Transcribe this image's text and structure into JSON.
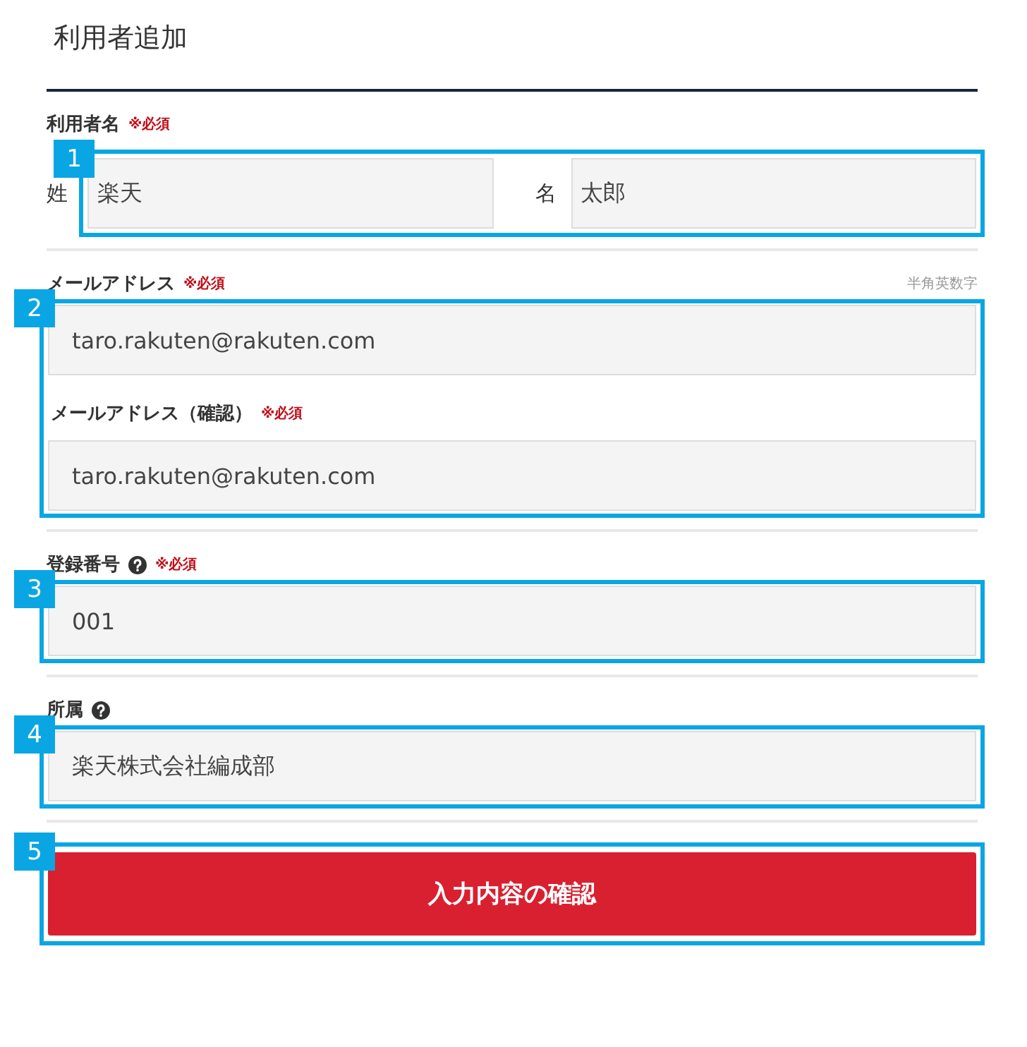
{
  "title": "利用者追加",
  "sections": [
    {
      "kind": "name",
      "label": "利用者名",
      "required": "※必須",
      "callout": "1",
      "fields": [
        {
          "label": "姓",
          "value": "楽天"
        },
        {
          "label": "名",
          "value": "太郎"
        }
      ]
    },
    {
      "kind": "email",
      "label": "メールアドレス",
      "required": "※必須",
      "note": "半角英数字",
      "callout": "2",
      "value": "taro.rakuten@rakuten.com",
      "confirm": {
        "label": "メールアドレス（確認）",
        "required": "※必須",
        "value": "taro.rakuten@rakuten.com"
      }
    },
    {
      "kind": "single",
      "label": "登録番号",
      "help": true,
      "required": "※必須",
      "callout": "3",
      "value": "001"
    },
    {
      "kind": "single",
      "label": "所属",
      "help": true,
      "callout": "4",
      "value": "楽天株式会社編成部"
    }
  ],
  "submit": {
    "label": "入力内容の確認",
    "callout": "5"
  }
}
